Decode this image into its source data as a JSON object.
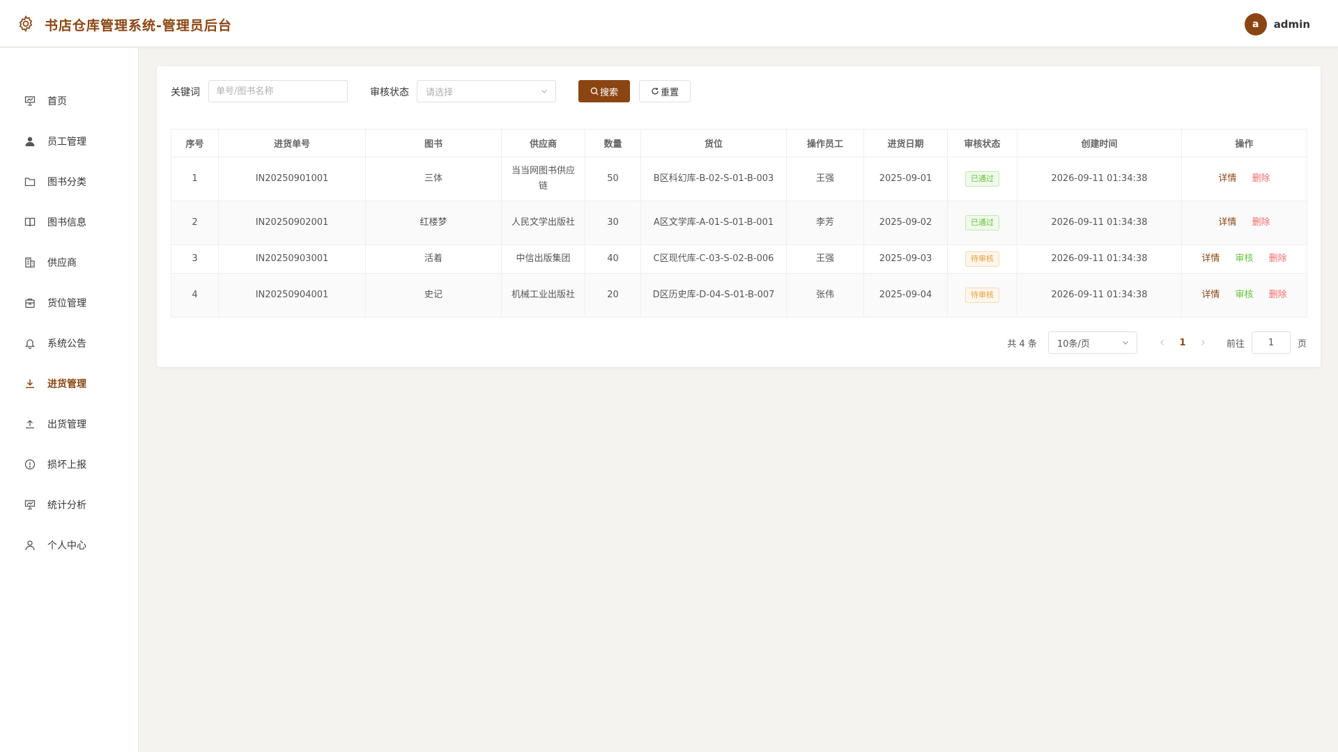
{
  "app": {
    "title": "书店仓库管理系统-管理员后台",
    "accent": "#8b4513",
    "icon": "gear-icon"
  },
  "user": {
    "avatar_letter": "a",
    "name": "admin"
  },
  "sidebar": {
    "items": [
      {
        "label": "首页",
        "icon": "presentation-icon"
      },
      {
        "label": "员工管理",
        "icon": "user-icon"
      },
      {
        "label": "图书分类",
        "icon": "folder-icon"
      },
      {
        "label": "图书信息",
        "icon": "book-icon"
      },
      {
        "label": "供应商",
        "icon": "building-icon"
      },
      {
        "label": "货位管理",
        "icon": "box-icon"
      },
      {
        "label": "系统公告",
        "icon": "bell-icon"
      },
      {
        "label": "进货管理",
        "icon": "download-icon",
        "active": true
      },
      {
        "label": "出货管理",
        "icon": "upload-icon"
      },
      {
        "label": "损坏上报",
        "icon": "warning-icon"
      },
      {
        "label": "统计分析",
        "icon": "chart-icon"
      },
      {
        "label": "个人中心",
        "icon": "user-outline-icon"
      }
    ]
  },
  "filters": {
    "keyword_label": "关键词",
    "keyword_placeholder": "单号/图书名称",
    "status_label": "审核状态",
    "status_placeholder": "请选择",
    "search_label": "搜索",
    "reset_label": "重置"
  },
  "table": {
    "columns": [
      "序号",
      "进货单号",
      "图书",
      "供应商",
      "数量",
      "货位",
      "操作员工",
      "进货日期",
      "审核状态",
      "创建时间",
      "操作"
    ],
    "rows": [
      {
        "index": "1",
        "order_no": "IN20250901001",
        "book": "三体",
        "supplier": "当当网图书供应链",
        "qty": "50",
        "location": "B区科幻库-B-02-S-01-B-003",
        "staff": "王强",
        "date": "2025-09-01",
        "status": "已通过",
        "status_type": "approved",
        "created": "2026-09-11 01:34:38",
        "actions": [
          "详情",
          "删除"
        ]
      },
      {
        "index": "2",
        "order_no": "IN20250902001",
        "book": "红楼梦",
        "supplier": "人民文学出版社",
        "qty": "30",
        "location": "A区文学库-A-01-S-01-B-001",
        "staff": "李芳",
        "date": "2025-09-02",
        "status": "已通过",
        "status_type": "approved",
        "created": "2026-09-11 01:34:38",
        "actions": [
          "详情",
          "删除"
        ]
      },
      {
        "index": "3",
        "order_no": "IN20250903001",
        "book": "活着",
        "supplier": "中信出版集团",
        "qty": "40",
        "location": "C区现代库-C-03-S-02-B-006",
        "staff": "王强",
        "date": "2025-09-03",
        "status": "待审核",
        "status_type": "pending",
        "created": "2026-09-11 01:34:38",
        "actions": [
          "详情",
          "审核",
          "删除"
        ]
      },
      {
        "index": "4",
        "order_no": "IN20250904001",
        "book": "史记",
        "supplier": "机械工业出版社",
        "qty": "20",
        "location": "D区历史库-D-04-S-01-B-007",
        "staff": "张伟",
        "date": "2025-09-04",
        "status": "待审核",
        "status_type": "pending",
        "created": "2026-09-11 01:34:38",
        "actions": [
          "详情",
          "审核",
          "删除"
        ]
      }
    ]
  },
  "pagination": {
    "total_text": "共 4 条",
    "page_size": "10条/页",
    "current_page": "1",
    "goto_label": "前往",
    "goto_value": "1",
    "page_suffix": "页"
  }
}
